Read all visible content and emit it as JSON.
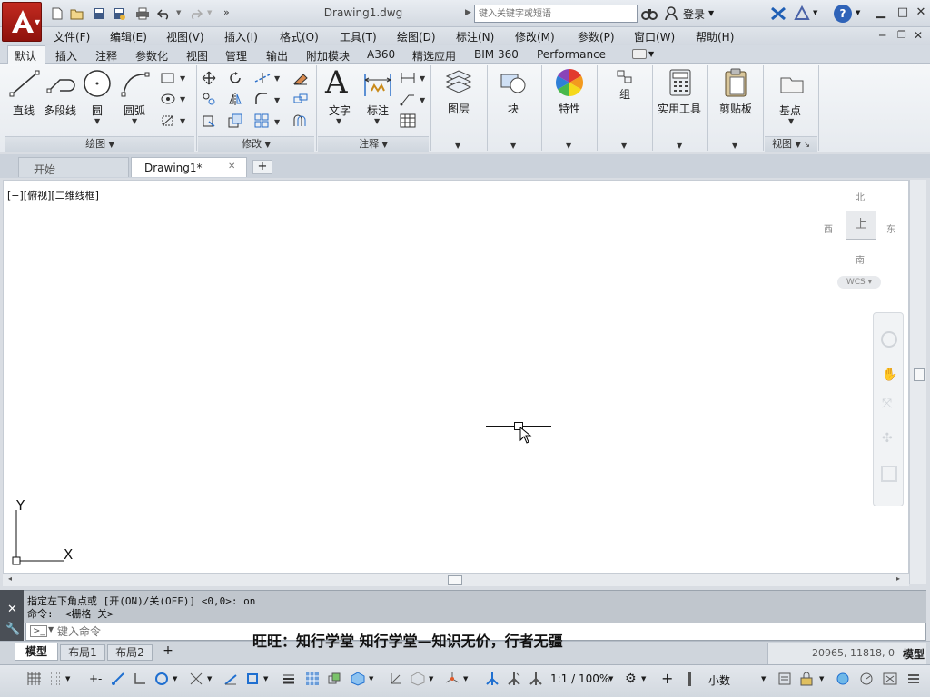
{
  "title_bar": {
    "document_title": "Drawing1.dwg",
    "search_placeholder": "键入关键字或短语",
    "login_label": "登录",
    "help_symbol": "?"
  },
  "menu": [
    "文件(F)",
    "编辑(E)",
    "视图(V)",
    "插入(I)",
    "格式(O)",
    "工具(T)",
    "绘图(D)",
    "标注(N)",
    "修改(M)",
    "参数(P)",
    "窗口(W)",
    "帮助(H)"
  ],
  "ribbon_tabs": [
    "默认",
    "插入",
    "注释",
    "参数化",
    "视图",
    "管理",
    "输出",
    "附加模块",
    "A360",
    "精选应用",
    "BIM 360",
    "Performance"
  ],
  "ribbon_active_tab": "默认",
  "ribbon": {
    "draw": {
      "line": "直线",
      "polyline": "多段线",
      "circle": "圆",
      "arc": "圆弧",
      "panel": "绘图"
    },
    "modify": {
      "panel": "修改"
    },
    "annotation": {
      "text": "文字",
      "dimension": "标注",
      "panel": "注释"
    },
    "layers": "图层",
    "block": "块",
    "properties": "特性",
    "groups": "组",
    "utilities": "实用工具",
    "clipboard": "剪贴板",
    "view": {
      "base": "基点",
      "panel": "视图"
    }
  },
  "doc_tabs": {
    "start": "开始",
    "drawing": "Drawing1*",
    "close": "✕",
    "add": "+"
  },
  "viewport_label": "[−][俯视][二维线框]",
  "viewcube": {
    "north": "北",
    "south": "南",
    "east": "东",
    "west": "西",
    "top": "上",
    "wcs": "WCS"
  },
  "ucs": {
    "x": "X",
    "y": "Y"
  },
  "command": {
    "history": [
      "指定左下角点或 [开(ON)/关(OFF)] <0,0>: on",
      "命令:  <栅格 关>"
    ],
    "input_placeholder": "键入命令"
  },
  "layout_tabs": [
    "模型",
    "布局1",
    "布局2"
  ],
  "layout_add": "+",
  "subtitle": "旺旺：知行学堂 知行学堂—知识无价，行者无疆",
  "status": {
    "coordinates": "20965, 11818, 0",
    "mode": "模型",
    "scale": "1:1 / 100%",
    "units": "小数"
  },
  "colors": {
    "accent_red": "#b5211a",
    "ribbon_bg": "#eef1f4",
    "canvas": "#ffffff"
  }
}
